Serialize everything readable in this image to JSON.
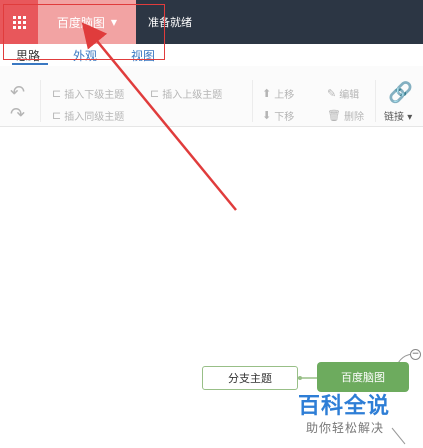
{
  "app": {
    "brand_label": "百度脑图",
    "status_text": "准备就绪"
  },
  "tabs": [
    {
      "label": "思路",
      "active": true
    },
    {
      "label": "外观",
      "active": false
    },
    {
      "label": "视图",
      "active": false
    }
  ],
  "toolbar": {
    "insert_child": "插入下级主题",
    "insert_parent": "插入上级主题",
    "insert_sibling": "插入同级主题",
    "move_up": "上移",
    "move_down": "下移",
    "edit": "编辑",
    "delete": "删除",
    "link": "链接"
  },
  "mindmap": {
    "root_topic": "百度脑图",
    "branch_topic": "分支主题"
  },
  "watermark": {
    "main": "百科全说",
    "sub": "助你轻松解决"
  },
  "colors": {
    "topbar": "#2c3644",
    "apps_button": "#e8575b",
    "brand_button": "#f2a3a3",
    "annotation_red": "#e03c3c",
    "tab_blue": "#3a78c2",
    "root_green": "#6dab5e",
    "branch_border": "#98bf87",
    "watermark_blue": "#2e7ed6"
  },
  "icons": {
    "apps": "grid-icon",
    "brand_dropdown": "caret-down-icon",
    "undo": "undo-icon",
    "redo": "redo-icon",
    "link": "chain-link-icon"
  }
}
